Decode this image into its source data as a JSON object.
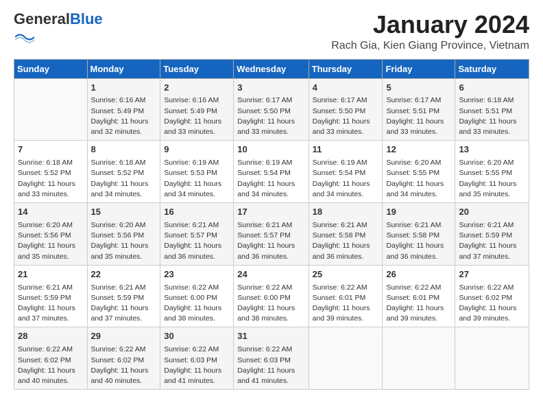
{
  "logo": {
    "general": "General",
    "blue": "Blue"
  },
  "header": {
    "title": "January 2024",
    "subtitle": "Rach Gia, Kien Giang Province, Vietnam"
  },
  "days_of_week": [
    "Sunday",
    "Monday",
    "Tuesday",
    "Wednesday",
    "Thursday",
    "Friday",
    "Saturday"
  ],
  "weeks": [
    [
      {
        "day": "",
        "info": ""
      },
      {
        "day": "1",
        "info": "Sunrise: 6:16 AM\nSunset: 5:49 PM\nDaylight: 11 hours and 32 minutes."
      },
      {
        "day": "2",
        "info": "Sunrise: 6:16 AM\nSunset: 5:49 PM\nDaylight: 11 hours and 33 minutes."
      },
      {
        "day": "3",
        "info": "Sunrise: 6:17 AM\nSunset: 5:50 PM\nDaylight: 11 hours and 33 minutes."
      },
      {
        "day": "4",
        "info": "Sunrise: 6:17 AM\nSunset: 5:50 PM\nDaylight: 11 hours and 33 minutes."
      },
      {
        "day": "5",
        "info": "Sunrise: 6:17 AM\nSunset: 5:51 PM\nDaylight: 11 hours and 33 minutes."
      },
      {
        "day": "6",
        "info": "Sunrise: 6:18 AM\nSunset: 5:51 PM\nDaylight: 11 hours and 33 minutes."
      }
    ],
    [
      {
        "day": "7",
        "info": "Sunrise: 6:18 AM\nSunset: 5:52 PM\nDaylight: 11 hours and 33 minutes."
      },
      {
        "day": "8",
        "info": "Sunrise: 6:18 AM\nSunset: 5:52 PM\nDaylight: 11 hours and 34 minutes."
      },
      {
        "day": "9",
        "info": "Sunrise: 6:19 AM\nSunset: 5:53 PM\nDaylight: 11 hours and 34 minutes."
      },
      {
        "day": "10",
        "info": "Sunrise: 6:19 AM\nSunset: 5:54 PM\nDaylight: 11 hours and 34 minutes."
      },
      {
        "day": "11",
        "info": "Sunrise: 6:19 AM\nSunset: 5:54 PM\nDaylight: 11 hours and 34 minutes."
      },
      {
        "day": "12",
        "info": "Sunrise: 6:20 AM\nSunset: 5:55 PM\nDaylight: 11 hours and 34 minutes."
      },
      {
        "day": "13",
        "info": "Sunrise: 6:20 AM\nSunset: 5:55 PM\nDaylight: 11 hours and 35 minutes."
      }
    ],
    [
      {
        "day": "14",
        "info": "Sunrise: 6:20 AM\nSunset: 5:56 PM\nDaylight: 11 hours and 35 minutes."
      },
      {
        "day": "15",
        "info": "Sunrise: 6:20 AM\nSunset: 5:56 PM\nDaylight: 11 hours and 35 minutes."
      },
      {
        "day": "16",
        "info": "Sunrise: 6:21 AM\nSunset: 5:57 PM\nDaylight: 11 hours and 36 minutes."
      },
      {
        "day": "17",
        "info": "Sunrise: 6:21 AM\nSunset: 5:57 PM\nDaylight: 11 hours and 36 minutes."
      },
      {
        "day": "18",
        "info": "Sunrise: 6:21 AM\nSunset: 5:58 PM\nDaylight: 11 hours and 36 minutes."
      },
      {
        "day": "19",
        "info": "Sunrise: 6:21 AM\nSunset: 5:58 PM\nDaylight: 11 hours and 36 minutes."
      },
      {
        "day": "20",
        "info": "Sunrise: 6:21 AM\nSunset: 5:59 PM\nDaylight: 11 hours and 37 minutes."
      }
    ],
    [
      {
        "day": "21",
        "info": "Sunrise: 6:21 AM\nSunset: 5:59 PM\nDaylight: 11 hours and 37 minutes."
      },
      {
        "day": "22",
        "info": "Sunrise: 6:21 AM\nSunset: 5:59 PM\nDaylight: 11 hours and 37 minutes."
      },
      {
        "day": "23",
        "info": "Sunrise: 6:22 AM\nSunset: 6:00 PM\nDaylight: 11 hours and 38 minutes."
      },
      {
        "day": "24",
        "info": "Sunrise: 6:22 AM\nSunset: 6:00 PM\nDaylight: 11 hours and 38 minutes."
      },
      {
        "day": "25",
        "info": "Sunrise: 6:22 AM\nSunset: 6:01 PM\nDaylight: 11 hours and 39 minutes."
      },
      {
        "day": "26",
        "info": "Sunrise: 6:22 AM\nSunset: 6:01 PM\nDaylight: 11 hours and 39 minutes."
      },
      {
        "day": "27",
        "info": "Sunrise: 6:22 AM\nSunset: 6:02 PM\nDaylight: 11 hours and 39 minutes."
      }
    ],
    [
      {
        "day": "28",
        "info": "Sunrise: 6:22 AM\nSunset: 6:02 PM\nDaylight: 11 hours and 40 minutes."
      },
      {
        "day": "29",
        "info": "Sunrise: 6:22 AM\nSunset: 6:02 PM\nDaylight: 11 hours and 40 minutes."
      },
      {
        "day": "30",
        "info": "Sunrise: 6:22 AM\nSunset: 6:03 PM\nDaylight: 11 hours and 41 minutes."
      },
      {
        "day": "31",
        "info": "Sunrise: 6:22 AM\nSunset: 6:03 PM\nDaylight: 11 hours and 41 minutes."
      },
      {
        "day": "",
        "info": ""
      },
      {
        "day": "",
        "info": ""
      },
      {
        "day": "",
        "info": ""
      }
    ]
  ]
}
